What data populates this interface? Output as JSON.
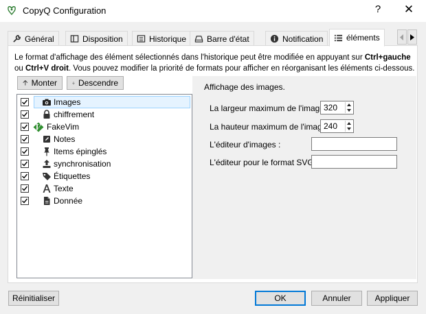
{
  "window": {
    "title": "CopyQ Configuration",
    "help": "?",
    "close": "✕"
  },
  "tabs": [
    {
      "label": "Général",
      "icon": "wrench-icon"
    },
    {
      "label": "Disposition",
      "icon": "layout-icon"
    },
    {
      "label": "Historique",
      "icon": "history-icon"
    },
    {
      "label": "Barre d'état",
      "icon": "tray-icon"
    },
    {
      "label": "Notification",
      "icon": "info-icon"
    },
    {
      "label": "éléments",
      "icon": "list-icon"
    }
  ],
  "active_tab": "éléments",
  "description": {
    "part1": "Le format d'affichage des élément sélectionnés dans l'historique peut être modifiée en appuyant sur ",
    "key1": "Ctrl+gauche",
    "part2": " ou ",
    "key2": "Ctrl+V droit",
    "part3": ". Vous pouvez modifier la priorité de formats pour afficher en réorganisant les éléments ci-dessous."
  },
  "move_buttons": {
    "up": "Monter",
    "down": "Descendre"
  },
  "plugins": [
    {
      "label": "Images",
      "icon": "camera-icon",
      "checked": true,
      "selected": true
    },
    {
      "label": "chiffrement",
      "icon": "lock-icon",
      "checked": true,
      "selected": false
    },
    {
      "label": "FakeVim",
      "icon": "vim-icon",
      "checked": true,
      "selected": false
    },
    {
      "label": "Notes",
      "icon": "note-icon",
      "checked": true,
      "selected": false
    },
    {
      "label": "Items épinglés",
      "icon": "pin-icon",
      "checked": true,
      "selected": false
    },
    {
      "label": "synchronisation",
      "icon": "upload-icon",
      "checked": true,
      "selected": false
    },
    {
      "label": "Étiquettes",
      "icon": "tag-icon",
      "checked": true,
      "selected": false
    },
    {
      "label": "Texte",
      "icon": "font-icon",
      "checked": true,
      "selected": false
    },
    {
      "label": "Donnée",
      "icon": "file-icon",
      "checked": true,
      "selected": false
    }
  ],
  "settings": {
    "section_title": "Affichage des images.",
    "max_width_label": "La largeur maximum de l'image :",
    "max_width_value": "320",
    "max_height_label": "La hauteur maximum de l'image :",
    "max_height_value": "240",
    "image_editor_label": "L'éditeur d'images :",
    "image_editor_value": "",
    "svg_editor_label": "L'éditeur pour le format SVG :",
    "svg_editor_value": ""
  },
  "buttons": {
    "reset": "Réinitialiser",
    "ok": "OK",
    "cancel": "Annuler",
    "apply": "Appliquer"
  },
  "colors": {
    "accent": "#0078d7",
    "selection": "#e5f3ff",
    "vim_green": "#2f8f2f"
  }
}
